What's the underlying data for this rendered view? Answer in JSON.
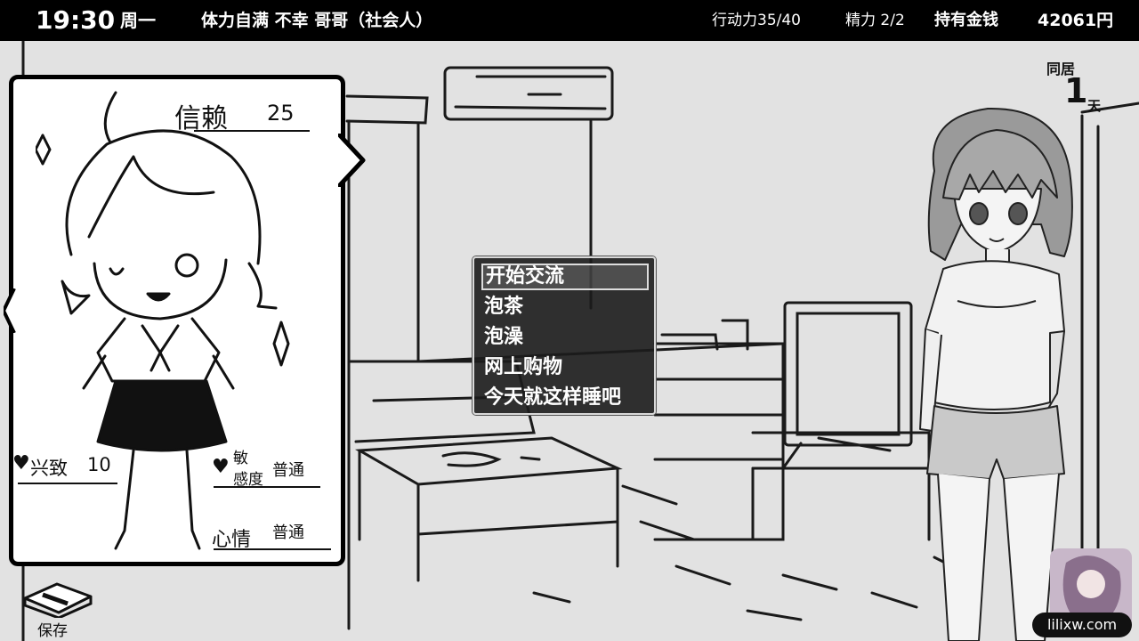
{
  "status_bar": {
    "time": "19:30",
    "weekday": "周一",
    "condition": "体力自满 不幸 哥哥（社会人）",
    "action_points": "行动力35/40",
    "energy": "精力 2/2",
    "money_label": "持有金钱",
    "money": "42061円"
  },
  "status_card": {
    "trust_label": "信赖",
    "trust_value": "25",
    "interest_label": "兴致",
    "interest_value": "10",
    "sensitivity_label_1": "敏",
    "sensitivity_label_2": "感度",
    "sensitivity_value": "普通",
    "mood_label": "心情",
    "mood_value": "普通"
  },
  "menu": {
    "items": [
      "开始交流",
      "泡茶",
      "泡澡",
      "网上购物",
      "今天就这样睡吧"
    ],
    "selected_index": 0
  },
  "cohabitation": {
    "label": "同居",
    "days": "1",
    "unit": "天"
  },
  "save": {
    "label": "保存"
  },
  "watermark": {
    "text": "lilixw.com"
  },
  "colors": {
    "bar": "#000000",
    "menu_bg": "#1c1c1c",
    "background": "#e2e2e2"
  }
}
